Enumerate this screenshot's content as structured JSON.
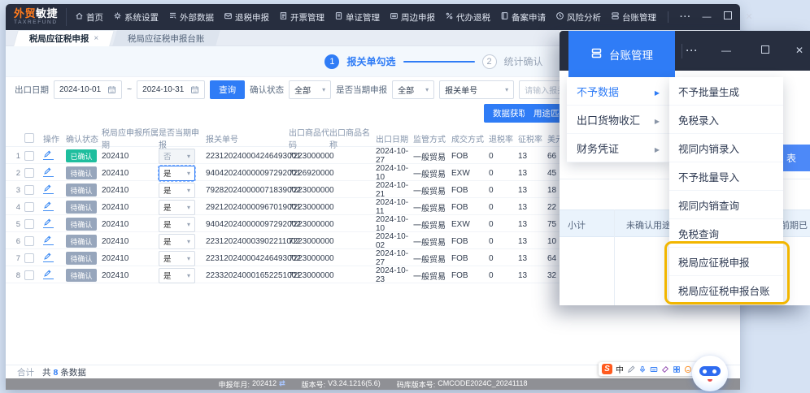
{
  "main_window": {
    "titlebar": {
      "logo": {
        "brand_left": "外贸",
        "brand_right": "敏捷",
        "subtitle": "TAXREFUND"
      },
      "nav": [
        {
          "icon": "home-icon",
          "label": "首页"
        },
        {
          "icon": "gear-icon",
          "label": "系统设置"
        },
        {
          "icon": "external-data-icon",
          "label": "外部数据"
        },
        {
          "icon": "tax-refund-icon",
          "label": "退税申报"
        },
        {
          "icon": "invoice-icon",
          "label": "开票管理"
        },
        {
          "icon": "document-icon",
          "label": "单证管理"
        },
        {
          "icon": "mail-icon",
          "label": "周边申报"
        },
        {
          "icon": "percent-icon",
          "label": "代办退税"
        },
        {
          "icon": "book-icon",
          "label": "备案申请"
        },
        {
          "icon": "clock-icon",
          "label": "风险分析"
        },
        {
          "icon": "ledger-icon",
          "label": "台账管理"
        }
      ]
    },
    "tabs": [
      {
        "label": "税局应征税申报",
        "active": true,
        "closable": true
      },
      {
        "label": "税局应征税申报台账",
        "active": false,
        "closable": false
      }
    ],
    "stepper": [
      {
        "num": "1",
        "label": "报关单勾选",
        "active": true
      },
      {
        "num": "2",
        "label": "统计确认",
        "active": false
      }
    ],
    "filters": {
      "export_date_label": "出口日期",
      "date_from": "2024-10-01",
      "date_to": "2024-10-31",
      "range_separator": "~",
      "search_button": "查询",
      "confirm_status_label": "确认状态",
      "confirm_status_value": "全部",
      "current_period_label": "是否当期申报",
      "current_period_value": "全部",
      "decl_type_value": "报关单号",
      "decl_input_placeholder": "请输入报关单号"
    },
    "actions": {
      "fetch_button": "数据获取",
      "match_button": "用途匹配"
    },
    "table": {
      "headers": [
        "操作",
        "确认状态",
        "税局应申报所属期",
        "是否当期申报",
        "报关单号",
        "出口商品代码",
        "出口商品名称",
        "出口日期",
        "监管方式",
        "成交方式",
        "退税率",
        "征税率",
        "美元"
      ],
      "rows": [
        {
          "no": "1",
          "status": "已确认",
          "status_type": "confirmed",
          "period": "202410",
          "current_period": "否",
          "current_disabled": true,
          "focused": false,
          "declaration_no": "223120240004246493001",
          "product_code": "7223000000",
          "product_name": "",
          "export_date": "2024-10-27",
          "supervision": "一般贸易",
          "incoterm": "FOB",
          "refund_rate": "0",
          "tax_rate": "13",
          "usd_value": "66"
        },
        {
          "no": "2",
          "status": "待确认",
          "status_type": "pending",
          "period": "202410",
          "current_period": "是",
          "current_disabled": false,
          "focused": true,
          "declaration_no": "940420240000097292001",
          "product_code": "7226920000",
          "product_name": "",
          "export_date": "2024-10-10",
          "supervision": "一般贸易",
          "incoterm": "EXW",
          "refund_rate": "0",
          "tax_rate": "13",
          "usd_value": "45"
        },
        {
          "no": "3",
          "status": "待确认",
          "status_type": "pending",
          "period": "202410",
          "current_period": "是",
          "current_disabled": false,
          "focused": false,
          "declaration_no": "792820240000071839002",
          "product_code": "7223000000",
          "product_name": "",
          "export_date": "2024-10-21",
          "supervision": "一般贸易",
          "incoterm": "FOB",
          "refund_rate": "0",
          "tax_rate": "13",
          "usd_value": "18"
        },
        {
          "no": "4",
          "status": "待确认",
          "status_type": "pending",
          "period": "202410",
          "current_period": "是",
          "current_disabled": false,
          "focused": false,
          "declaration_no": "292120240000967019001",
          "product_code": "7223000000",
          "product_name": "",
          "export_date": "2024-10-11",
          "supervision": "一般贸易",
          "incoterm": "FOB",
          "refund_rate": "0",
          "tax_rate": "13",
          "usd_value": "22"
        },
        {
          "no": "5",
          "status": "待确认",
          "status_type": "pending",
          "period": "202410",
          "current_period": "是",
          "current_disabled": false,
          "focused": false,
          "declaration_no": "940420240000097292002",
          "product_code": "7223000000",
          "product_name": "",
          "export_date": "2024-10-10",
          "supervision": "一般贸易",
          "incoterm": "EXW",
          "refund_rate": "0",
          "tax_rate": "13",
          "usd_value": "75"
        },
        {
          "no": "6",
          "status": "待确认",
          "status_type": "pending",
          "period": "202410",
          "current_period": "是",
          "current_disabled": false,
          "focused": false,
          "declaration_no": "223120240003902211002",
          "product_code": "7223000000",
          "product_name": "",
          "export_date": "2024-10-02",
          "supervision": "一般贸易",
          "incoterm": "FOB",
          "refund_rate": "0",
          "tax_rate": "13",
          "usd_value": "10"
        },
        {
          "no": "7",
          "status": "待确认",
          "status_type": "pending",
          "period": "202410",
          "current_period": "是",
          "current_disabled": false,
          "focused": false,
          "declaration_no": "223120240004246493002",
          "product_code": "7223000000",
          "product_name": "",
          "export_date": "2024-10-27",
          "supervision": "一般贸易",
          "incoterm": "FOB",
          "refund_rate": "0",
          "tax_rate": "13",
          "usd_value": "64"
        },
        {
          "no": "8",
          "status": "待确认",
          "status_type": "pending",
          "period": "202410",
          "current_period": "是",
          "current_disabled": false,
          "focused": false,
          "declaration_no": "223320240001652251001",
          "product_code": "7223000000",
          "product_name": "",
          "export_date": "2024-10-23",
          "supervision": "一般贸易",
          "incoterm": "FOB",
          "refund_rate": "0",
          "tax_rate": "13",
          "usd_value": "32"
        }
      ]
    },
    "footer": {
      "total_label": "合计",
      "count_prefix": "共",
      "count": "8",
      "count_suffix": "条数据"
    },
    "statusbar": {
      "period_label": "申报年月:",
      "period_value": "202412",
      "version_label": "版本号:",
      "version_value": "V3.24.1216(5.6)",
      "codebase_label": "码库版本号:",
      "codebase_value": "CMCODE2024C_20241118"
    }
  },
  "overlay_window": {
    "titlebar": {
      "menu_button": "台账管理"
    },
    "menu": {
      "items": [
        {
          "label": "不予数据",
          "active": true
        },
        {
          "label": "出口货物收汇",
          "active": false
        },
        {
          "label": "财务凭证",
          "active": false
        }
      ]
    },
    "submenu": {
      "items": [
        "不予批量生成",
        "免税录入",
        "视同内销录入",
        "不予批量导入",
        "视同内销查询",
        "免税查询",
        "税局应征税申报",
        "税局应征税申报台账"
      ],
      "highlighted": [
        "税局应征税申报",
        "税局应征税申报台账"
      ]
    },
    "page_fragments": {
      "button_fragment": "表",
      "subtotal": "小计",
      "unconfirmed": "未确认用途",
      "prior_period": "前期已"
    }
  },
  "ime_bar": {
    "logo": "S",
    "mode": "中"
  }
}
